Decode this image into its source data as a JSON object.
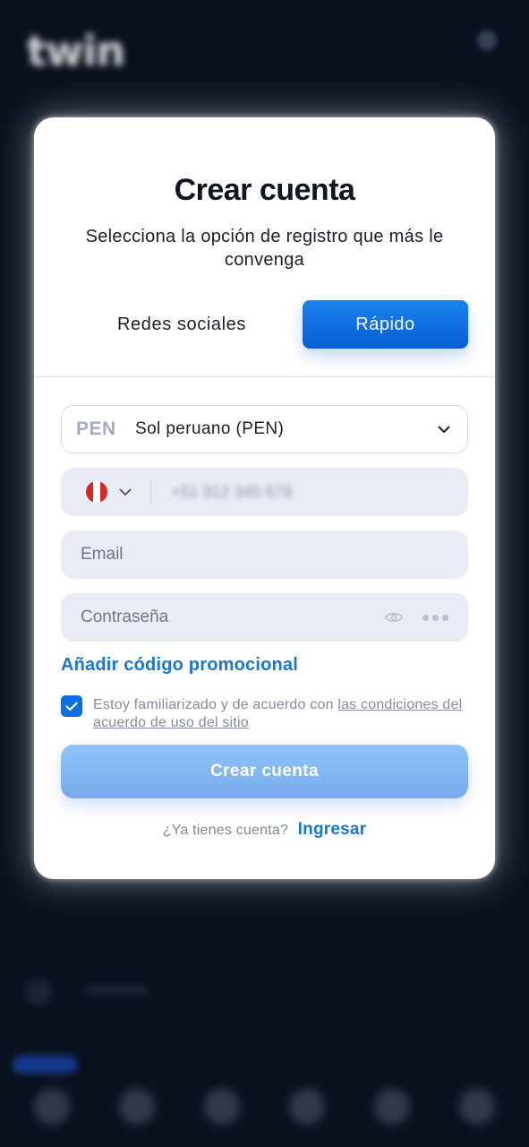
{
  "background": {
    "logo": "twin"
  },
  "modal": {
    "title": "Crear cuenta",
    "subtitle": "Selecciona la opción de registro que más le convenga",
    "tabs": [
      {
        "label": "Redes sociales",
        "active": false
      },
      {
        "label": "Rápido",
        "active": true
      }
    ],
    "currency": {
      "code": "PEN",
      "name": "Sol peruano (PEN)"
    },
    "phone": {
      "country": "Peru",
      "value": "+51 912 345 678"
    },
    "email": {
      "placeholder": "Email"
    },
    "password": {
      "placeholder": "Contraseña"
    },
    "promo_link": "Añadir código promocional",
    "terms": {
      "checked": true,
      "text": "Estoy familiarizado y de acuerdo con ",
      "link": "las condiciones del acuerdo de uso del sitio"
    },
    "submit_label": "Crear cuenta",
    "login": {
      "prompt": "¿Ya tienes cuenta?",
      "link": "Ingresar"
    }
  },
  "colors": {
    "accent": "#1677d2",
    "primary_button": "#0a5ed4",
    "submit_disabled": "#8ec5f9",
    "backdrop": "#0b1322"
  }
}
